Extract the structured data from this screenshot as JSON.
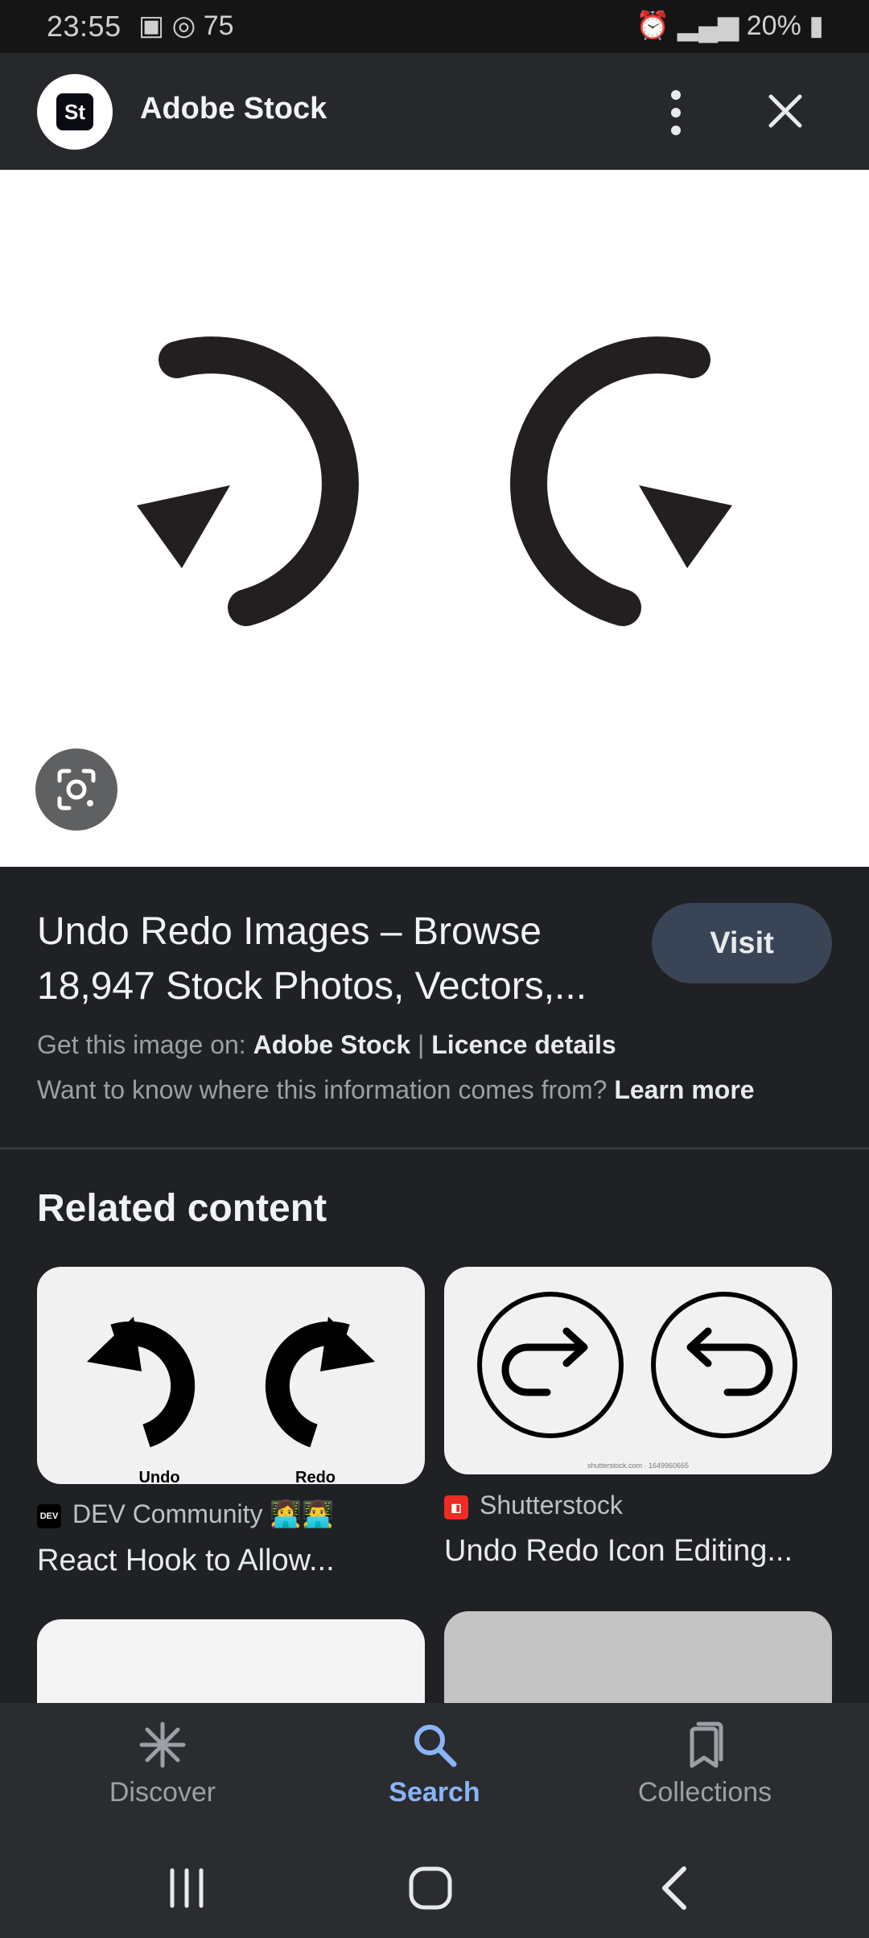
{
  "status_bar": {
    "time": "23:55",
    "notification_count": "75",
    "battery": "20%"
  },
  "top_bar": {
    "logo_text": "St",
    "title": "Adobe Stock"
  },
  "result": {
    "title_line1": "Undo Redo Images – Browse",
    "title_line2": "18,947 Stock Photos, Vectors,...",
    "visit_label": "Visit",
    "source_prefix": "Get this image on:",
    "source_name": "Adobe Stock",
    "separator": "|",
    "licence_label": "Licence details",
    "info_question": "Want to know where this information comes from?",
    "learn_more": "Learn more"
  },
  "related": {
    "heading": "Related content",
    "cards": [
      {
        "source": "DEV Community 👩‍💻👨‍💻",
        "source_icon_text": "DEV",
        "title": "React Hook to Allow...",
        "image_labels": [
          "Undo",
          "Redo"
        ]
      },
      {
        "source": "Shutterstock",
        "title": "Undo Redo Icon Editing...",
        "watermark": "shutterstock.com · 1649960665"
      }
    ]
  },
  "bottom_nav": {
    "items": [
      {
        "label": "Discover",
        "icon": "asterisk-icon",
        "active": false
      },
      {
        "label": "Search",
        "icon": "search-icon",
        "active": true
      },
      {
        "label": "Collections",
        "icon": "bookmarks-icon",
        "active": false
      }
    ]
  },
  "colors": {
    "background": "#202124",
    "accent": "#8ab4f8",
    "visit_button": "#394457"
  }
}
